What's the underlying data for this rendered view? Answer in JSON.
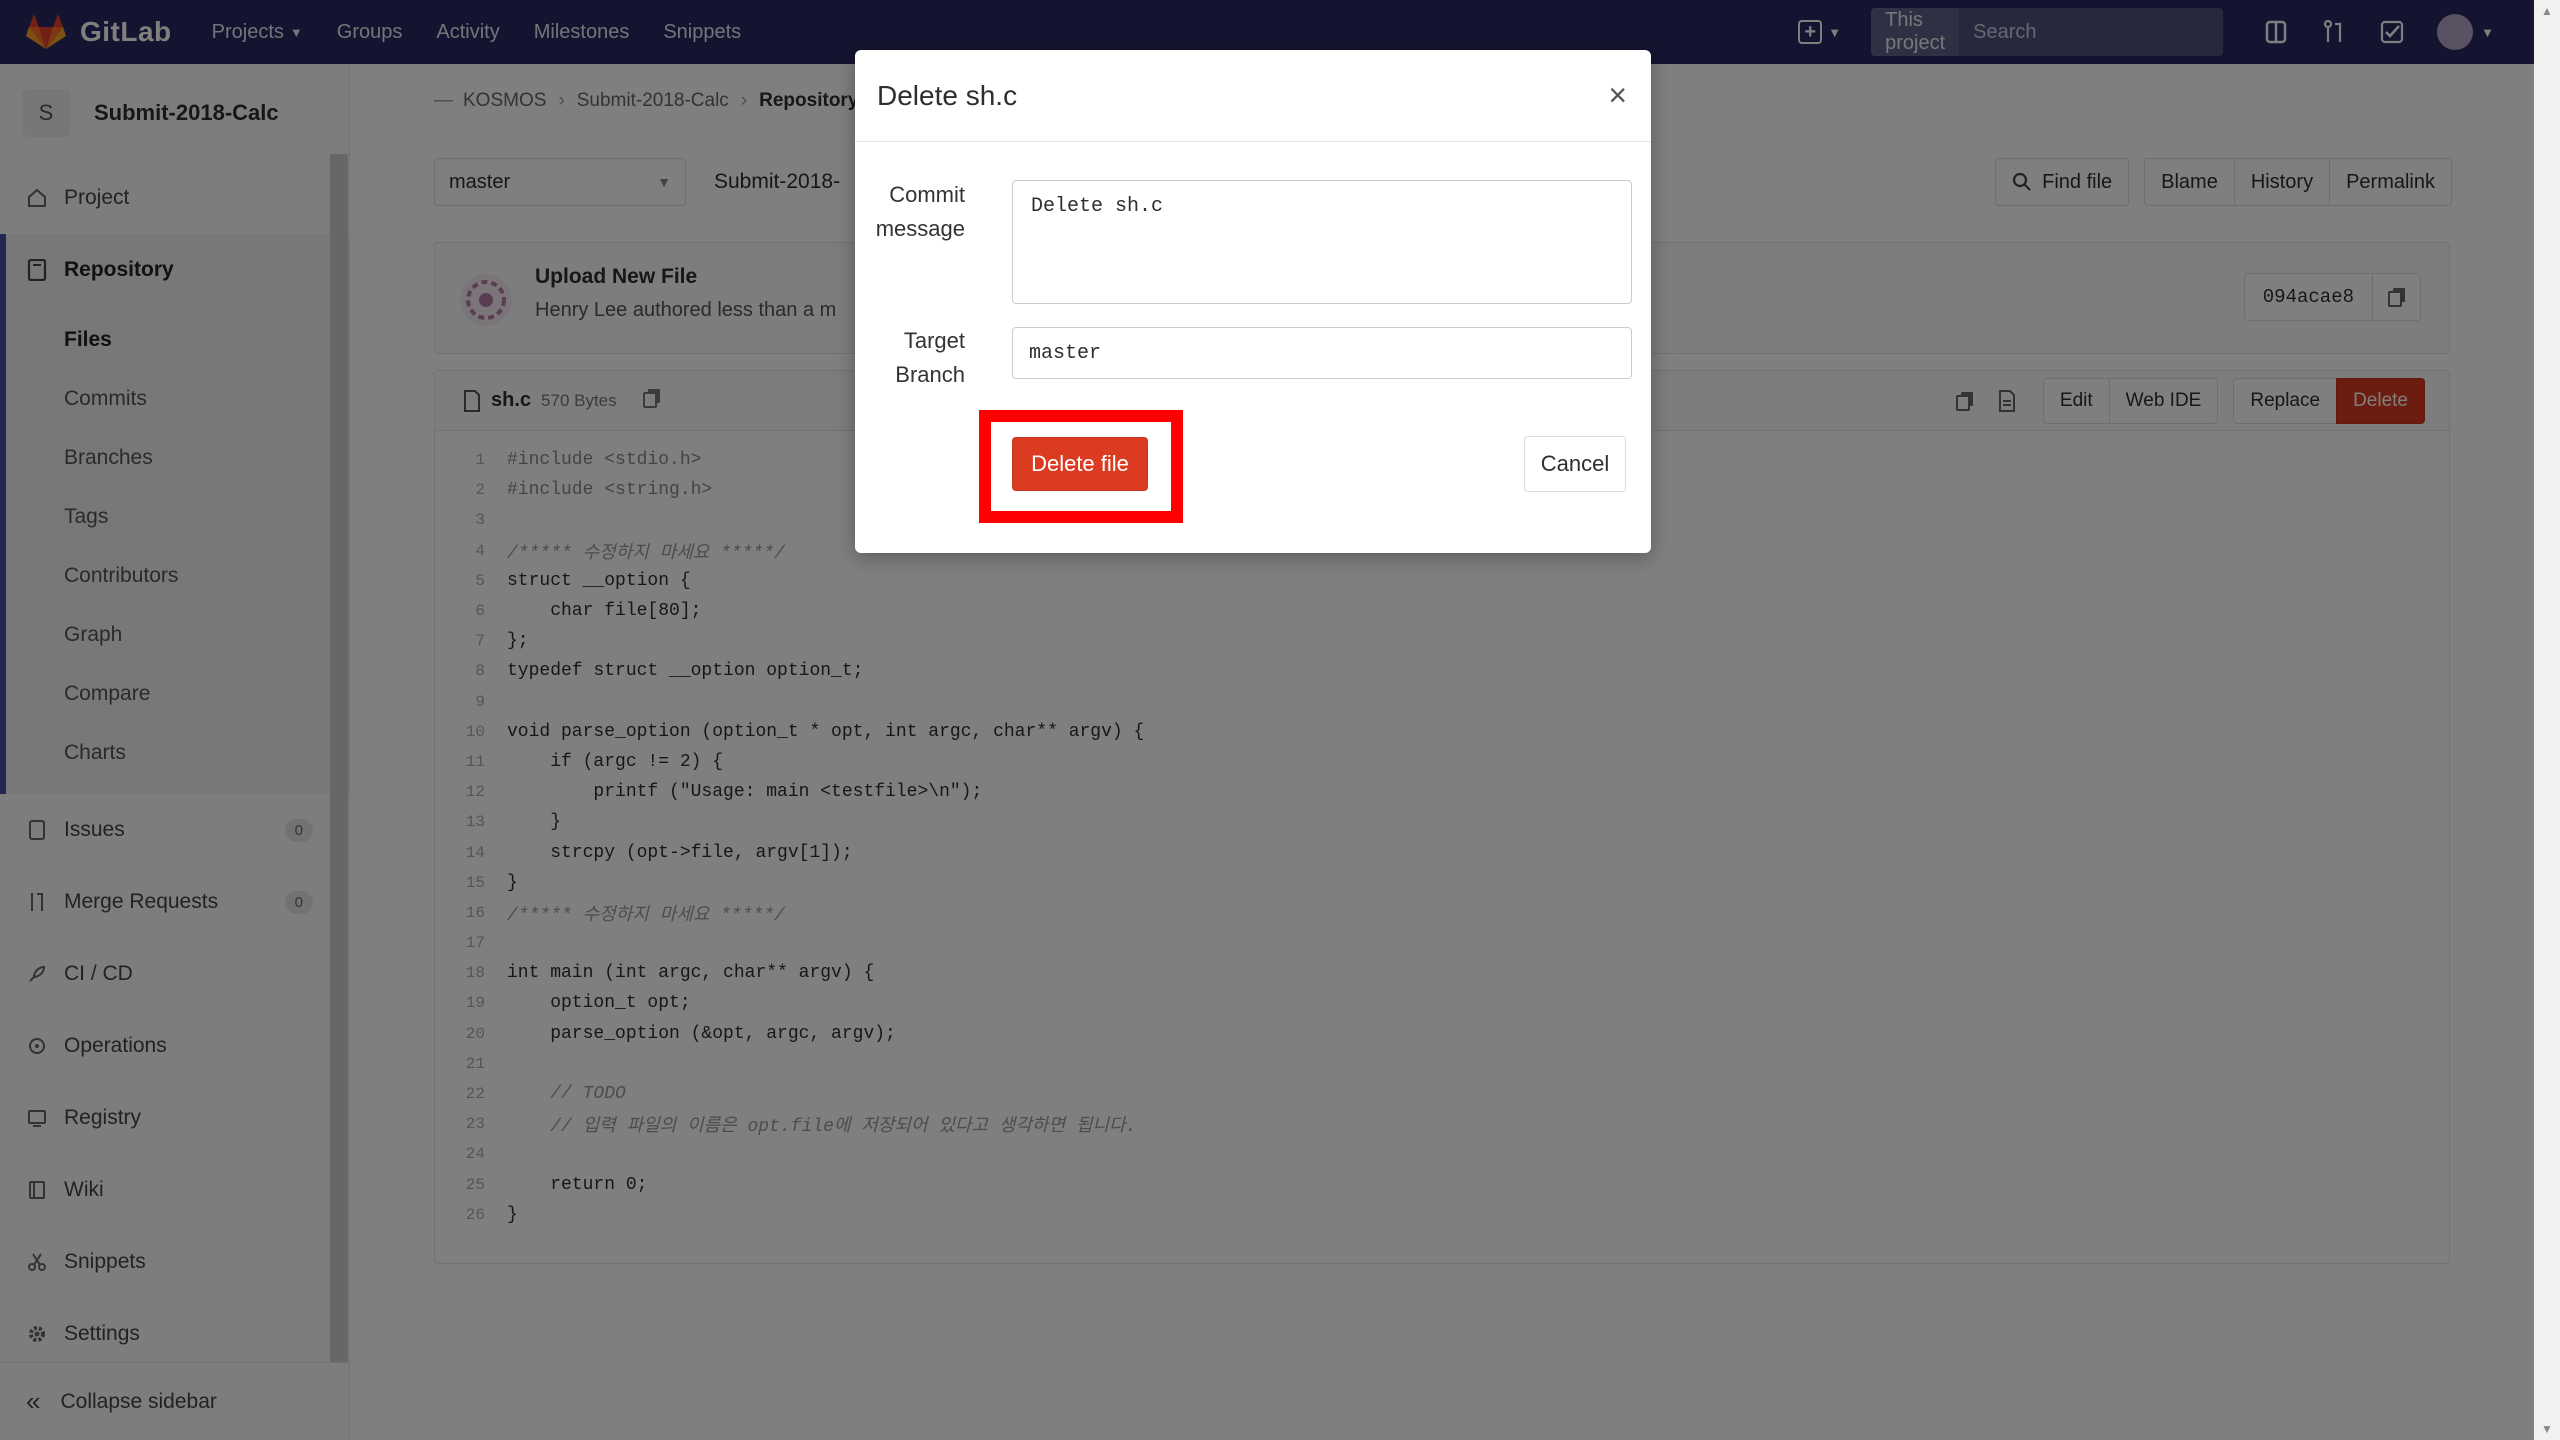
{
  "navbar": {
    "brand": "GitLab",
    "links": [
      {
        "label": "Projects",
        "has_dropdown": true
      },
      {
        "label": "Groups"
      },
      {
        "label": "Activity"
      },
      {
        "label": "Milestones"
      },
      {
        "label": "Snippets"
      }
    ],
    "search_scope": "This project",
    "search_placeholder": "Search",
    "icons": [
      "plus-square-icon",
      "search-icon",
      "sidebar-panel-icon",
      "merge-request-icon",
      "todo-check-icon",
      "user-avatar"
    ]
  },
  "sidebar": {
    "project_initial": "S",
    "project_name": "Submit-2018-Calc",
    "items": [
      {
        "label": "Project",
        "icon": "home-icon"
      },
      {
        "label": "Repository",
        "icon": "repository-icon",
        "active": true
      },
      {
        "label": "Issues",
        "icon": "issues-icon",
        "badge": "0"
      },
      {
        "label": "Merge Requests",
        "icon": "merge-request-icon",
        "badge": "0"
      },
      {
        "label": "CI / CD",
        "icon": "rocket-icon"
      },
      {
        "label": "Operations",
        "icon": "operations-icon"
      },
      {
        "label": "Registry",
        "icon": "registry-icon"
      },
      {
        "label": "Wiki",
        "icon": "wiki-icon"
      },
      {
        "label": "Snippets",
        "icon": "snippets-icon"
      },
      {
        "label": "Settings",
        "icon": "gear-icon"
      }
    ],
    "repository_sub": [
      "Files",
      "Commits",
      "Branches",
      "Tags",
      "Contributors",
      "Graph",
      "Compare",
      "Charts"
    ],
    "collapse_label": "Collapse sidebar"
  },
  "main": {
    "breadcrumb": [
      "KOSMOS",
      "Submit-2018-Calc",
      "Repository"
    ],
    "branch": "master",
    "path": "Submit-2018-",
    "find_file": "Find file",
    "view_buttons": [
      "Blame",
      "History",
      "Permalink"
    ],
    "commit": {
      "title": "Upload New File",
      "author": "Henry Lee authored less than a m",
      "sha": "094acae8"
    },
    "file": {
      "name": "sh.c",
      "size": "570 Bytes",
      "actions": [
        "Edit",
        "Web IDE",
        "Replace"
      ],
      "delete_label": "Delete"
    },
    "code_lines": [
      "#include <stdio.h>",
      "#include <string.h>",
      "",
      "/***** 수정하지 마세요 *****/",
      "struct __option {",
      "    char file[80];",
      "};",
      "typedef struct __option option_t;",
      "",
      "void parse_option (option_t * opt, int argc, char** argv) {",
      "    if (argc != 2) {",
      "        printf (\"Usage: main <testfile>\\n\");",
      "    }",
      "    strcpy (opt->file, argv[1]);",
      "}",
      "/***** 수정하지 마세요 *****/",
      "",
      "int main (int argc, char** argv) {",
      "    option_t opt;",
      "    parse_option (&opt, argc, argv);",
      "",
      "    // TODO",
      "    // 입력 파일의 이름은 opt.file에 저장되어 있다고 생각하면 됩니다.",
      "",
      "    return 0;",
      "}"
    ]
  },
  "modal": {
    "title": "Delete sh.c",
    "close": "×",
    "commit_label_1": "Commit",
    "commit_label_2": "message",
    "commit_message": "Delete sh.c",
    "branch_label_1": "Target",
    "branch_label_2": "Branch",
    "target_branch": "master",
    "delete_button": "Delete file",
    "cancel_button": "Cancel"
  },
  "colors": {
    "navbar": "#292961",
    "danger": "#db3b21",
    "highlight": "#ff0000"
  }
}
